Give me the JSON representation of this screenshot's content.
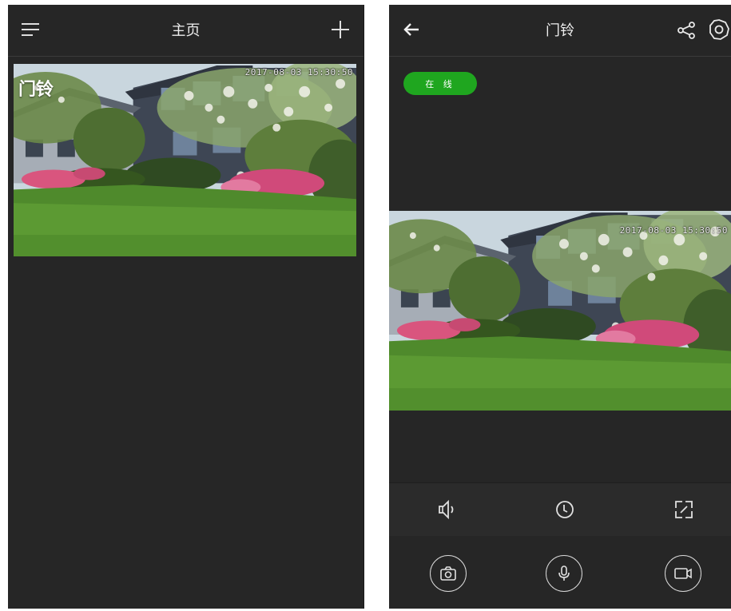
{
  "home": {
    "title": "主页",
    "camera_card": {
      "device_name": "门铃",
      "timestamp": "2017-08-03 15:30:50"
    }
  },
  "device": {
    "title": "门铃",
    "status": "在 线",
    "timestamp": "2017-08-03 15:30:50",
    "controls": [
      "speaker-icon",
      "history-clock-icon",
      "fullscreen-icon"
    ],
    "actions": [
      "snapshot-icon",
      "microphone-icon",
      "record-video-icon"
    ]
  },
  "colors": {
    "background": "#262626",
    "status_green": "#1fa61f",
    "icon": "#e0e0e0"
  }
}
